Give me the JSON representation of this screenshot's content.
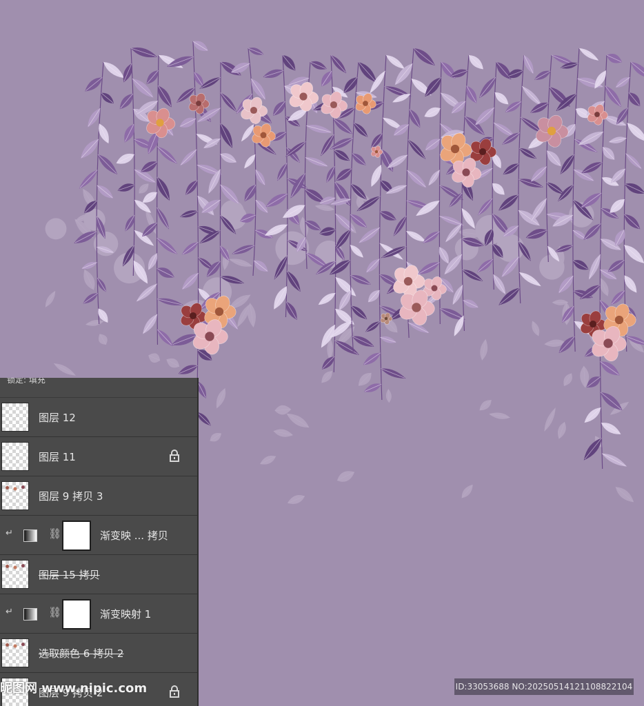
{
  "canvas": {
    "background": "#a08fae"
  },
  "panel": {
    "toolbar_fragment": "锁定: 填充",
    "layers": [
      {
        "name": "图层",
        "num": "12",
        "kind": "pixel",
        "locked": false,
        "struck": false
      },
      {
        "name": "图层",
        "num": "11",
        "kind": "pixel",
        "locked": true,
        "struck": false
      },
      {
        "name": "图层",
        "num": "9 拷贝 3",
        "kind": "pixel",
        "locked": false,
        "struck": false
      },
      {
        "name": "渐变映 ... 拷贝",
        "num": "",
        "kind": "adjustment",
        "locked": false,
        "struck": false
      },
      {
        "name": "图层",
        "num": "15 拷贝",
        "kind": "pixel",
        "locked": false,
        "struck": true
      },
      {
        "name": "渐变映射",
        "num": "1",
        "kind": "adjustment",
        "locked": false,
        "struck": false
      },
      {
        "name": "选取颜色",
        "num": "6 拷贝 2",
        "kind": "pixel",
        "locked": false,
        "struck": true
      },
      {
        "name": "图层",
        "num": "9 拷贝 2",
        "kind": "pixel",
        "locked": true,
        "struck": false
      }
    ]
  },
  "watermark": {
    "text": "昵图网 www.nipic.com"
  },
  "id_bar": {
    "text": "ID:33053688 NO:20250514121108822104"
  },
  "colors": {
    "panel_bg": "#4a4a4a",
    "leaf_dark": "#5e3f7a",
    "leaf_light": "#c7b6d6",
    "flower_peach": "#e89a73",
    "flower_pink": "#e8b6bf"
  }
}
